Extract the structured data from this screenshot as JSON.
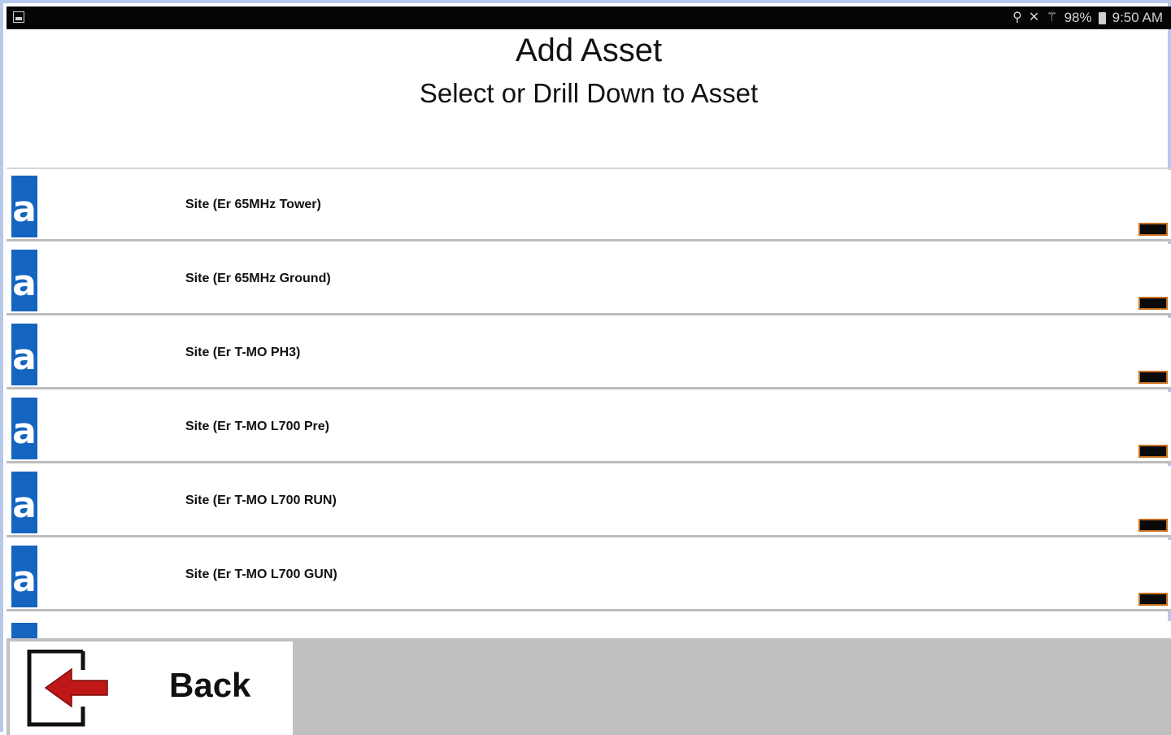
{
  "status_bar": {
    "icons": [
      "location-icon",
      "mute-icon",
      "signal-icon"
    ],
    "battery": "98%",
    "time": "9:50 AM"
  },
  "header": {
    "title": "Add Asset",
    "subtitle": "Select or Drill Down to Asset"
  },
  "assets": {
    "icon_letter": "a",
    "items": [
      {
        "label": "Site (Er 65MHz Tower)"
      },
      {
        "label": "Site (Er 65MHz Ground)"
      },
      {
        "label": "Site (Er T-MO PH3)"
      },
      {
        "label": "Site (Er T-MO L700 Pre)"
      },
      {
        "label": "Site (Er T-MO L700 RUN)"
      },
      {
        "label": "Site (Er T-MO L700 GUN)"
      }
    ]
  },
  "footer": {
    "back_label": "Back"
  },
  "colors": {
    "accent_blue": "#1565c0",
    "back_arrow_red": "#c01818",
    "handle_orange": "#c8701e"
  }
}
